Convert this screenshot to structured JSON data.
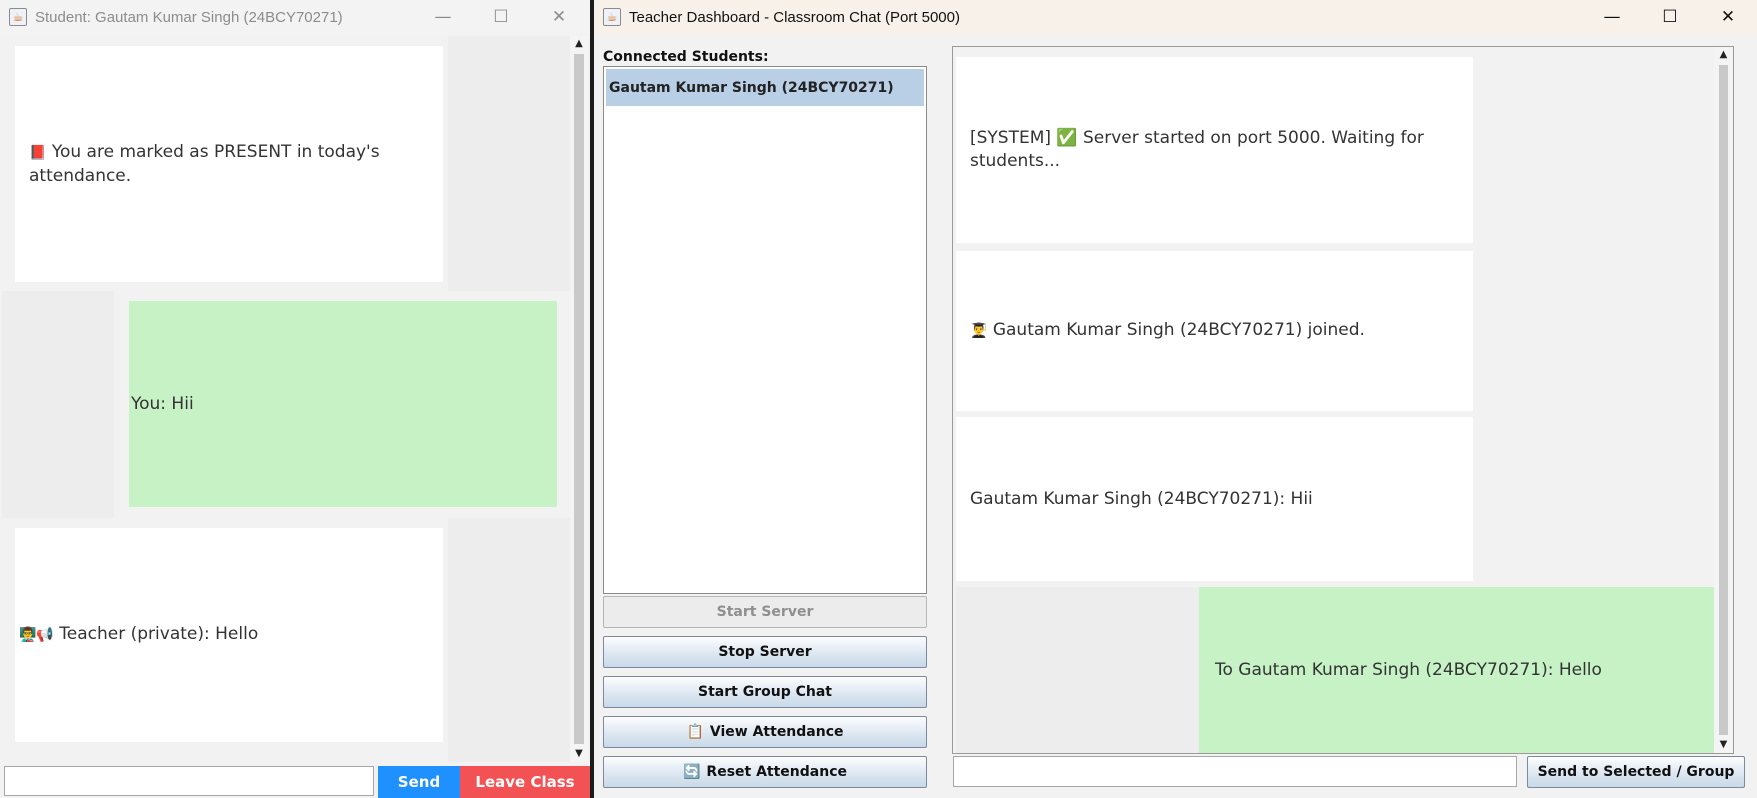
{
  "student_window": {
    "title": "Student: Gautam Kumar Singh (24BCY70271)",
    "controls": {
      "minimize": "—",
      "maximize": "☐",
      "close": "✕"
    },
    "messages": [
      {
        "icon": "📕",
        "text": "You are marked as PRESENT in today's attendance."
      },
      {
        "text": "You: Hii"
      },
      {
        "icon": "👨‍🏫📢",
        "text": "Teacher (private): Hello"
      }
    ],
    "input": {
      "value": "",
      "placeholder": ""
    },
    "send_label": "Send",
    "leave_label": "Leave Class"
  },
  "teacher_window": {
    "title": "Teacher Dashboard - Classroom Chat (Port 5000)",
    "controls": {
      "minimize": "—",
      "maximize": "☐",
      "close": "✕"
    },
    "students_label": "Connected Students:",
    "students": [
      "Gautam Kumar Singh (24BCY70271)"
    ],
    "buttons": {
      "start_server": "Start Server",
      "stop_server": "Stop Server",
      "start_group_chat": "Start Group Chat",
      "view_attendance": "View Attendance",
      "reset_attendance": "Reset Attendance"
    },
    "messages": [
      {
        "text": "[SYSTEM] ✅ Server started on port 5000. Waiting for students..."
      },
      {
        "icon": "👨‍🎓",
        "text": "Gautam Kumar Singh (24BCY70271) joined."
      },
      {
        "text": "Gautam Kumar Singh (24BCY70271): Hii"
      },
      {
        "text": "To Gautam Kumar Singh (24BCY70271): Hello"
      }
    ],
    "input": {
      "value": "",
      "placeholder": ""
    },
    "send_label": "Send to Selected / Group"
  },
  "colors": {
    "own_message": "#c6f2c6",
    "other_message": "#ffffff",
    "send_button": "#1e90ff",
    "leave_button": "#f25253",
    "list_selection": "#b8cfe5"
  }
}
